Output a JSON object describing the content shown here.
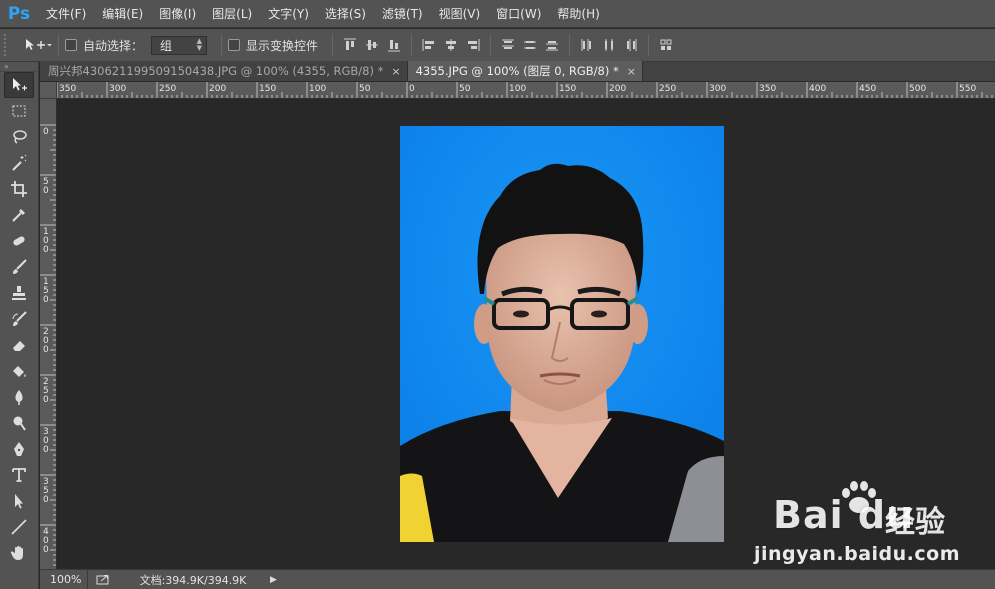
{
  "app": {
    "logo": "Ps"
  },
  "menu": [
    "文件(F)",
    "编辑(E)",
    "图像(I)",
    "图层(L)",
    "文字(Y)",
    "选择(S)",
    "滤镜(T)",
    "视图(V)",
    "窗口(W)",
    "帮助(H)"
  ],
  "options": {
    "auto_select_label": "自动选择：",
    "auto_select_value": "组",
    "show_transform_label": "显示变换控件",
    "auto_select_checked": false,
    "show_transform_checked": false
  },
  "tabs": [
    {
      "label": "周兴邦430621199509150438.JPG @ 100% (4355, RGB/8) *",
      "active": false
    },
    {
      "label": "4355.JPG @ 100% (图层 0, RGB/8) *",
      "active": true
    }
  ],
  "tab_close_glyph": "×",
  "rulers": {
    "h_labels": [
      "350",
      "300",
      "250",
      "200",
      "150",
      "100",
      "50",
      "0",
      "50",
      "100",
      "150",
      "200",
      "250",
      "300",
      "350",
      "400",
      "450",
      "500",
      "550"
    ],
    "v_labels": [
      "0",
      "50",
      "100",
      "150",
      "200",
      "250",
      "300",
      "350",
      "400"
    ]
  },
  "tools": [
    "move-icon",
    "marquee-icon",
    "lasso-icon",
    "magic-wand-icon",
    "crop-icon",
    "eyedropper-icon",
    "healing-brush-icon",
    "brush-icon",
    "clone-stamp-icon",
    "history-brush-icon",
    "eraser-icon",
    "paint-bucket-icon",
    "blur-icon",
    "dodge-icon",
    "pen-icon",
    "type-icon",
    "path-selection-icon",
    "line-icon",
    "hand-icon"
  ],
  "status": {
    "zoom": "100%",
    "doc_info": "文档:394.9K/394.9K",
    "arrow": "▶"
  },
  "watermark": {
    "logo_text": "Bai du",
    "logo_cn": "经验",
    "url": "jingyan.baidu.com"
  },
  "colors": {
    "chrome": "#535353",
    "workspace": "#282828",
    "photo_bg": "#0d86f2",
    "ps_blue": "#2fa3f5"
  }
}
